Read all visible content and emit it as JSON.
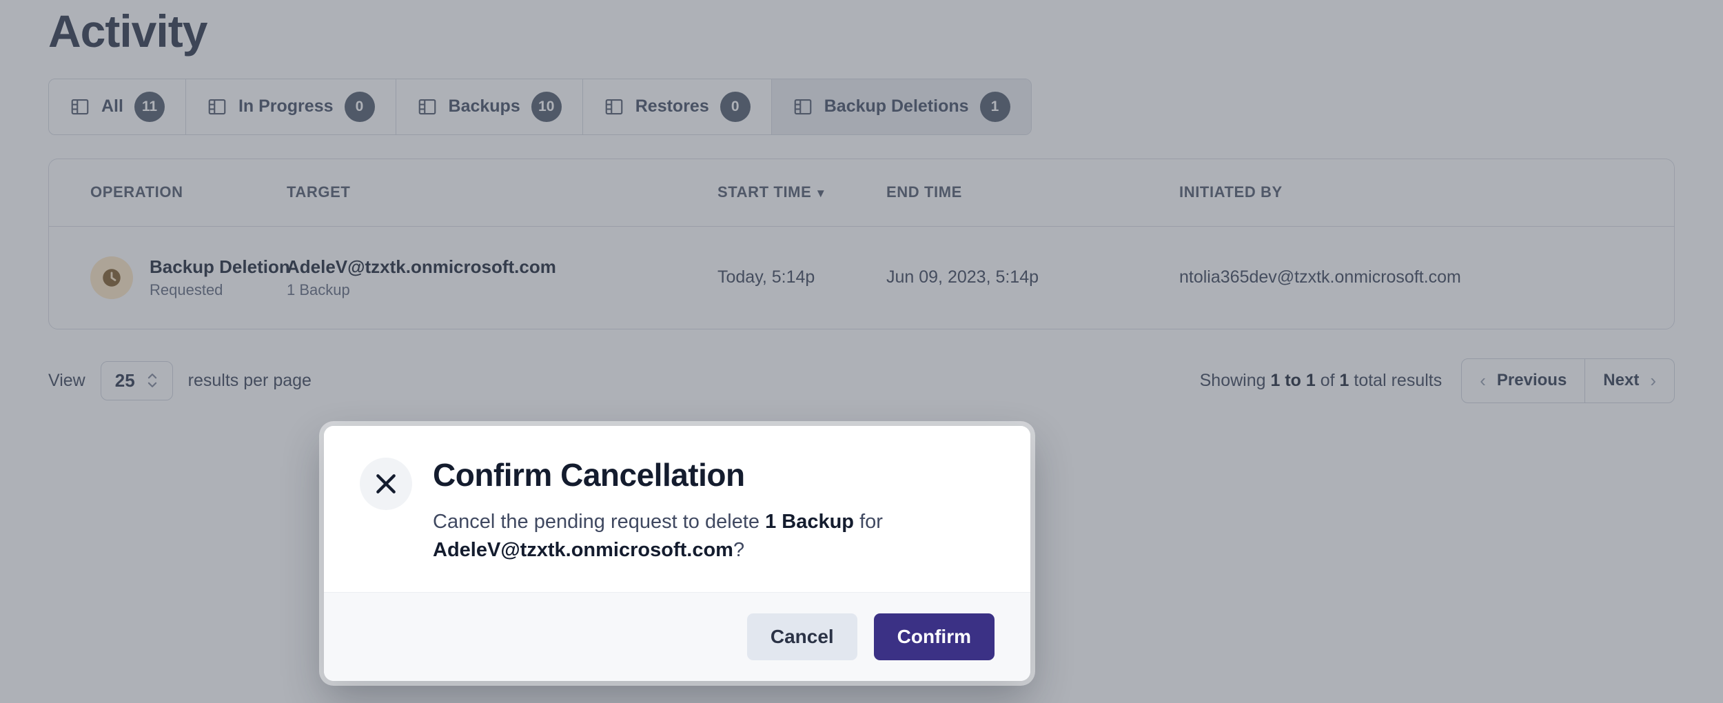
{
  "page": {
    "title": "Activity"
  },
  "tabs": [
    {
      "label": "All",
      "badge": "11",
      "icon": "panel-icon",
      "selected": false
    },
    {
      "label": "In Progress",
      "badge": "0",
      "icon": "panel-icon",
      "selected": false
    },
    {
      "label": "Backups",
      "badge": "10",
      "icon": "panel-icon",
      "selected": false
    },
    {
      "label": "Restores",
      "badge": "0",
      "icon": "panel-icon",
      "selected": false
    },
    {
      "label": "Backup Deletions",
      "badge": "1",
      "icon": "panel-icon",
      "selected": true
    }
  ],
  "table": {
    "columns": [
      {
        "label": "OPERATION",
        "sorted": false
      },
      {
        "label": "TARGET",
        "sorted": false
      },
      {
        "label": "START TIME",
        "sorted": true,
        "sort_caret": "▼"
      },
      {
        "label": "END TIME",
        "sorted": false
      },
      {
        "label": "INITIATED BY",
        "sorted": false
      }
    ],
    "rows": [
      {
        "status_icon": "clock-icon",
        "operation": "Backup Deletion",
        "operation_status": "Requested",
        "target": "AdeleV@tzxtk.onmicrosoft.com",
        "target_sub": "1 Backup",
        "start_time": "Today, 5:14p",
        "end_time": "Jun 09, 2023, 5:14p",
        "initiated_by": "ntolia365dev@tzxtk.onmicrosoft.com"
      }
    ]
  },
  "pagination": {
    "view_label": "View",
    "page_size": "25",
    "per_page_label": "results per page",
    "showing_prefix": "Showing",
    "showing_range": "1 to 1",
    "showing_of": "of",
    "showing_total": "1",
    "showing_suffix": "total results",
    "previous_label": "Previous",
    "next_label": "Next",
    "prev_chevron": "‹",
    "next_chevron": "›"
  },
  "modal": {
    "icon": "x-icon",
    "title": "Confirm Cancellation",
    "message_part1": "Cancel the pending request to delete ",
    "message_bold1": "1 Backup",
    "message_part2": " for ",
    "message_bold2": "AdeleV@tzxtk.onmicrosoft.com",
    "message_part3": "?",
    "cancel_label": "Cancel",
    "confirm_label": "Confirm"
  },
  "colors": {
    "confirm_button": "#3b3185",
    "cancel_button": "#e2e7ef",
    "status_badge": "#5e6878",
    "status_dot_bg": "#fde8c8",
    "overlay": "rgba(61,68,84,0.42)"
  }
}
